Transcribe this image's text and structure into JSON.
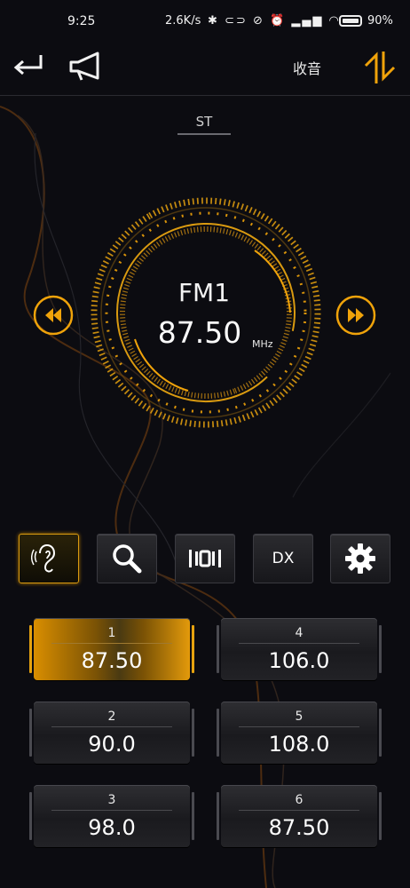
{
  "status_bar": {
    "time": "9:25",
    "net_speed": "2.6K/s",
    "battery_pct": "90%"
  },
  "header": {
    "title": "收音"
  },
  "stereo_label": "ST",
  "tuner": {
    "band": "FM1",
    "frequency": "87.50",
    "unit": "MHz"
  },
  "function_buttons": {
    "dx_label": "DX"
  },
  "presets": [
    {
      "number": "1",
      "frequency": "87.50",
      "active": true
    },
    {
      "number": "2",
      "frequency": "90.0",
      "active": false
    },
    {
      "number": "3",
      "frequency": "98.0",
      "active": false
    },
    {
      "number": "4",
      "frequency": "106.0",
      "active": false
    },
    {
      "number": "5",
      "frequency": "108.0",
      "active": false
    },
    {
      "number": "6",
      "frequency": "87.50",
      "active": false
    }
  ],
  "colors": {
    "accent": "#f0a30a",
    "background": "#0c0c11",
    "panel": "#1e1e22"
  }
}
